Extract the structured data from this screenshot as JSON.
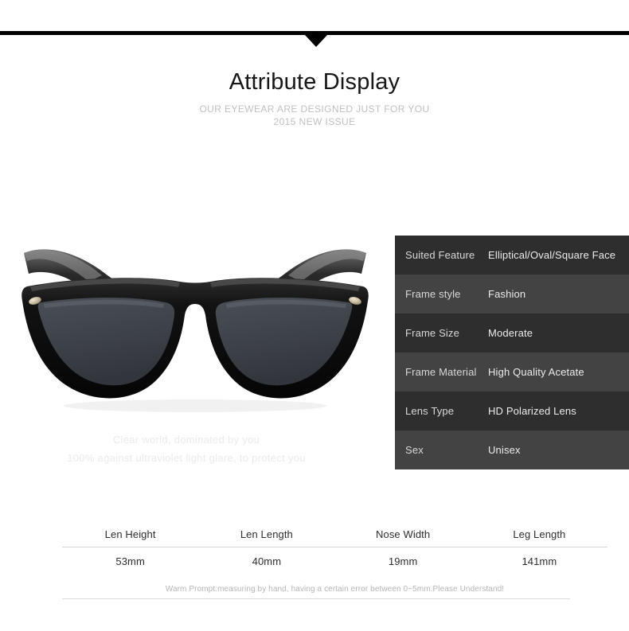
{
  "topbar": {
    "notch_icon": "triangle-down-icon",
    "accent_color": "#000000"
  },
  "header": {
    "title": "Attribute Display",
    "subtitle_line1": "OUR EYEWEAR ARE DESIGNED JUST FOR YOU",
    "subtitle_line2": "2015 NEW ISSUE"
  },
  "product": {
    "image_name": "black-wayfarer-sunglasses-front-view",
    "frame_color": "#0b0b0b",
    "lens_color": "#3e4248"
  },
  "tagline": {
    "line1": "Clear world, dominated by you",
    "line2": "100% against ultraviolet light glare, to protect you",
    "color": "#ebebeb"
  },
  "spec_table": {
    "row_color_odd": "#2e2e2e",
    "row_color_even": "#434343",
    "rows": [
      {
        "label": "Suited Feature",
        "value": "Elliptical/Oval/Square Face"
      },
      {
        "label": "Frame style",
        "value": "Fashion"
      },
      {
        "label": "Frame Size",
        "value": "Moderate"
      },
      {
        "label": "Frame Material",
        "value": "High Quality Acetate"
      },
      {
        "label": "Lens Type",
        "value": "HD Polarized Lens"
      },
      {
        "label": "Sex",
        "value": "Unisex"
      }
    ]
  },
  "measurements": {
    "headers": [
      "Len Height",
      "Len Length",
      "Nose Width",
      "Leg Length"
    ],
    "values": [
      "53mm",
      "40mm",
      "19mm",
      "141mm"
    ],
    "warn_prompt": "Warm Prompt:measuring by hand, having a certain error between 0−5mm.Please Understand!"
  }
}
